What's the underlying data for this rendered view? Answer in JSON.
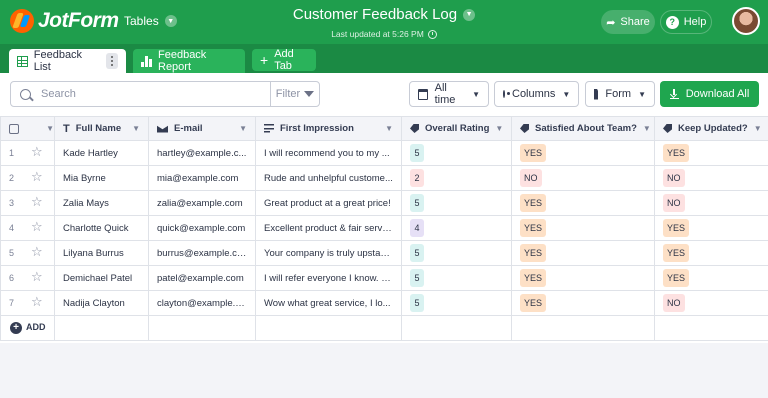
{
  "header": {
    "logo_text": "JotForm",
    "tables_menu": "Tables",
    "title": "Customer Feedback Log",
    "subtitle": "Last updated at 5:26 PM",
    "share_label": "Share",
    "help_label": "Help"
  },
  "tabs": {
    "active": "Feedback List",
    "report": "Feedback Report",
    "add": "Add Tab"
  },
  "toolbar": {
    "search_placeholder": "Search",
    "filter_label": "Filter",
    "time_label": "All time",
    "columns_label": "Columns",
    "form_label": "Form",
    "download_label": "Download All"
  },
  "table": {
    "columns": [
      "Full Name",
      "E-mail",
      "First Impression",
      "Overall Rating",
      "Satisfied About Team?",
      "Keep Updated?"
    ],
    "rows": [
      {
        "num": "1",
        "name": "Kade Hartley",
        "email": "hartley@example.c...",
        "impression": "I will recommend you to my ...",
        "rating": "5",
        "satisfied": "YES",
        "keep": "YES"
      },
      {
        "num": "2",
        "name": "Mia Byrne",
        "email": "mia@example.com",
        "impression": "Rude and unhelpful custome...",
        "rating": "2",
        "satisfied": "NO",
        "keep": "NO"
      },
      {
        "num": "3",
        "name": "Zalia Mays",
        "email": "zalia@example.com",
        "impression": "Great product at a great price!",
        "rating": "5",
        "satisfied": "YES",
        "keep": "NO"
      },
      {
        "num": "4",
        "name": "Charlotte Quick",
        "email": "quick@example.com",
        "impression": "Excellent product & fair service",
        "rating": "4",
        "satisfied": "YES",
        "keep": "YES"
      },
      {
        "num": "5",
        "name": "Lilyana Burrus",
        "email": "burrus@example.com",
        "impression": "Your company is truly upstan...",
        "rating": "5",
        "satisfied": "YES",
        "keep": "YES"
      },
      {
        "num": "6",
        "name": "Demichael Patel",
        "email": "patel@example.com",
        "impression": "I will refer everyone I know. I ...",
        "rating": "5",
        "satisfied": "YES",
        "keep": "YES"
      },
      {
        "num": "7",
        "name": "Nadija Clayton",
        "email": "clayton@example.com",
        "impression": "Wow what great service, I lo...",
        "rating": "5",
        "satisfied": "YES",
        "keep": "NO"
      }
    ],
    "add_label": "ADD"
  },
  "colors": {
    "brand_green": "#1f9e4d",
    "tab_bar": "#1b8a44",
    "yes_bg": "#fde0c6",
    "no_bg": "#fde1e1",
    "rating_5_bg": "#d9f2f1",
    "rating_4_bg": "#e6e0f6",
    "rating_2_bg": "#fde1e1"
  }
}
